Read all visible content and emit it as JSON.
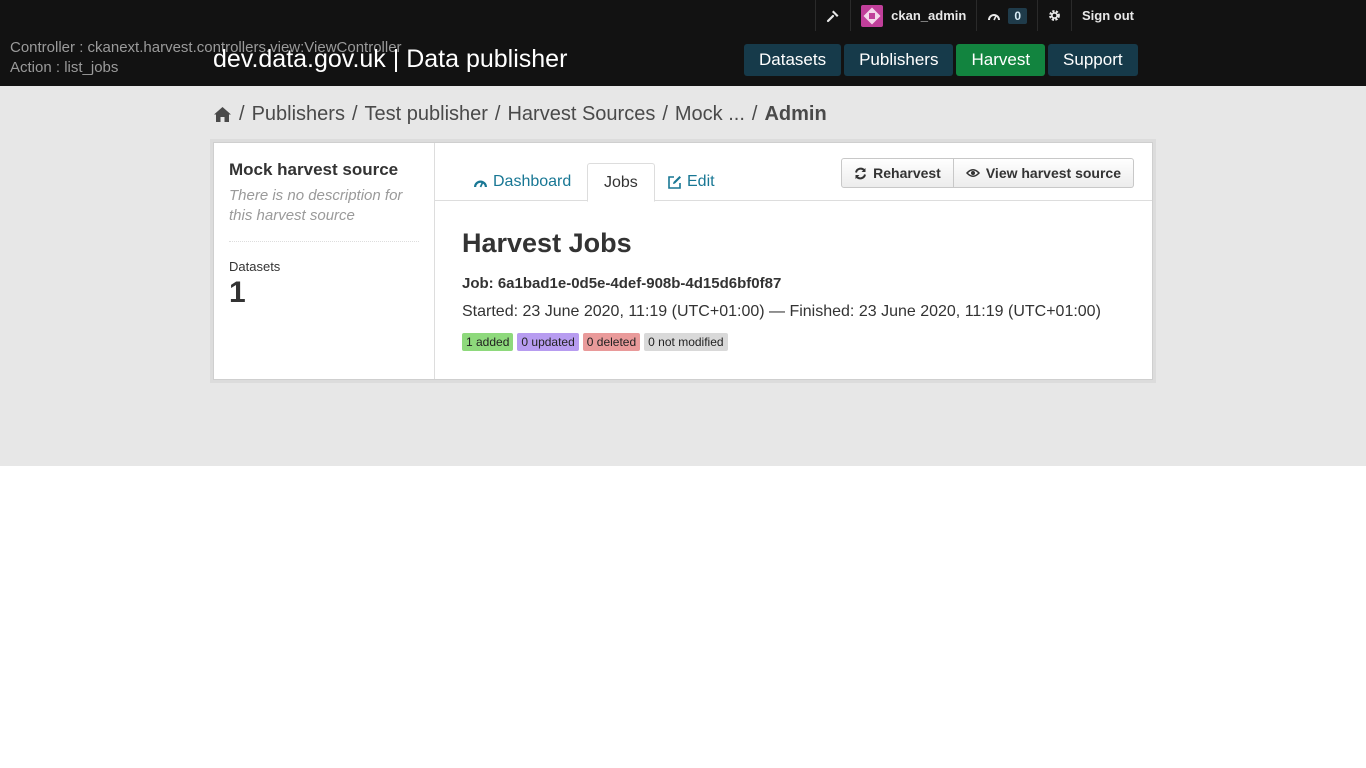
{
  "debug": {
    "controller": "Controller : ckanext.harvest.controllers.view:ViewController",
    "action": "Action : list_jobs"
  },
  "site": {
    "title": "dev.data.gov.uk | Data publisher"
  },
  "account": {
    "username": "ckan_admin",
    "dashboard_count": "0",
    "sign_out": "Sign out"
  },
  "nav": {
    "items": [
      {
        "label": "Datasets"
      },
      {
        "label": "Publishers"
      },
      {
        "label": "Harvest"
      },
      {
        "label": "Support"
      }
    ],
    "active": "Harvest"
  },
  "breadcrumb": {
    "items": [
      "Publishers",
      "Test publisher",
      "Harvest Sources",
      "Mock ..."
    ],
    "current": "Admin"
  },
  "source": {
    "title": "Mock harvest source",
    "description": "There is no description for this harvest source",
    "stat_label": "Datasets",
    "stat_value": "1"
  },
  "tabs": {
    "dashboard": "Dashboard",
    "jobs": "Jobs",
    "edit": "Edit",
    "active": "Jobs"
  },
  "actions": {
    "reharvest": "Reharvest",
    "view_source": "View harvest source"
  },
  "jobs": {
    "heading": "Harvest Jobs",
    "job_id": "Job: 6a1bad1e-0d5e-4def-908b-4d15d6bf0f87",
    "times": "Started: 23 June 2020, 11:19 (UTC+01:00) — Finished: 23 June 2020, 11:19 (UTC+01:00)",
    "badges": {
      "added": "1 added",
      "updated": "0 updated",
      "deleted": "0 deleted",
      "not_modified": "0 not modified"
    }
  },
  "colors": {
    "header_bg": "#121212",
    "nav_bg": "#163a4a",
    "nav_active": "#12843f",
    "link": "#187794",
    "badge_added": "#8ed97c",
    "badge_updated": "#b79cf0",
    "badge_deleted": "#e99a9a",
    "badge_not_modified": "#d9d9d9"
  },
  "icons": [
    "wrench-icon",
    "avatar",
    "dashboard-icon",
    "gear-icon",
    "home-icon",
    "refresh-icon",
    "eye-icon",
    "edit-icon"
  ]
}
